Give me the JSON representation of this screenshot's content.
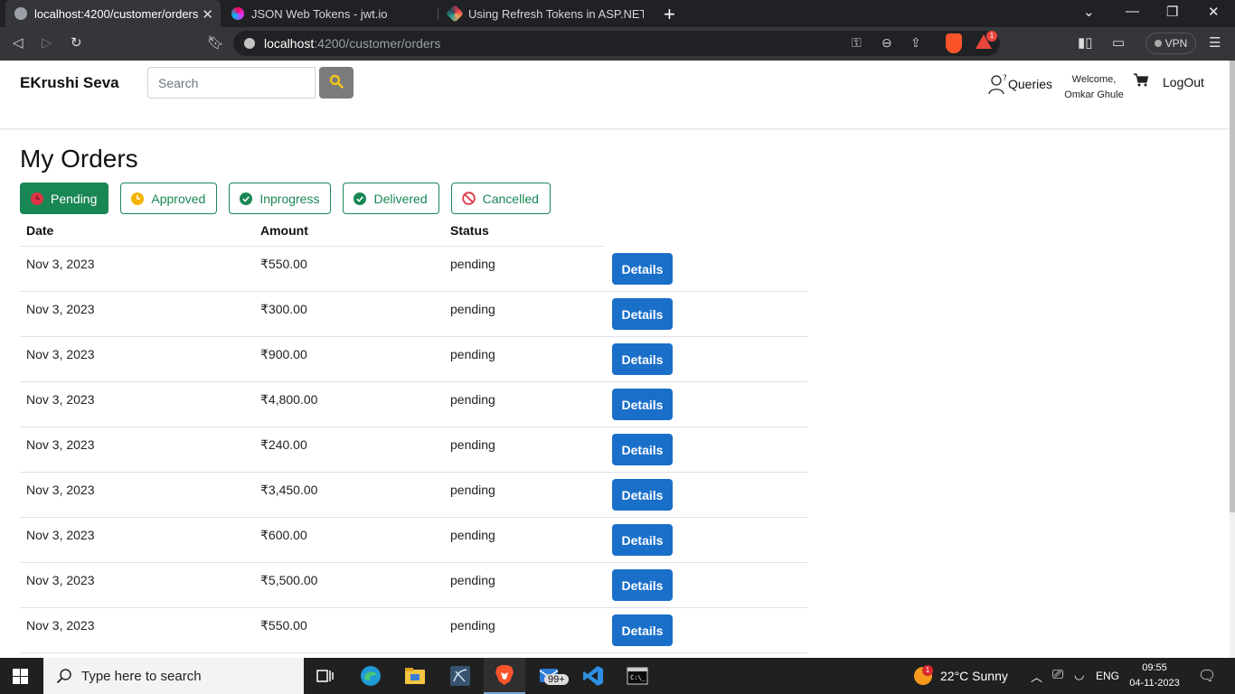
{
  "browser": {
    "tabs": [
      {
        "title": "localhost:4200/customer/orders",
        "active": true
      },
      {
        "title": "JSON Web Tokens - jwt.io",
        "active": false
      },
      {
        "title": "Using Refresh Tokens in ASP.NET Core",
        "active": false
      }
    ],
    "url_host": "localhost",
    "url_rest": ":4200/customer/orders",
    "vpn_label": "VPN",
    "rewards_badge": "1"
  },
  "navbar": {
    "brand": "EKrushi Seva",
    "search_placeholder": "Search",
    "queries_label": "Queries",
    "welcome_line1": "Welcome,",
    "welcome_line2": "Omkar Ghule",
    "logout_label": "LogOut"
  },
  "page": {
    "title": "My Orders",
    "filters": [
      {
        "label": "Pending",
        "icon": "clock-red-icon",
        "active": true
      },
      {
        "label": "Approved",
        "icon": "clock-yellow-icon",
        "active": false
      },
      {
        "label": "Inprogress",
        "icon": "check-green-icon",
        "active": false
      },
      {
        "label": "Delivered",
        "icon": "check-green-icon",
        "active": false
      },
      {
        "label": "Cancelled",
        "icon": "ban-red-icon",
        "active": false
      }
    ],
    "columns": {
      "date": "Date",
      "amount": "Amount",
      "status": "Status"
    },
    "details_label": "Details",
    "orders": [
      {
        "date": "Nov 3, 2023",
        "amount": "₹550.00",
        "status": "pending"
      },
      {
        "date": "Nov 3, 2023",
        "amount": "₹300.00",
        "status": "pending"
      },
      {
        "date": "Nov 3, 2023",
        "amount": "₹900.00",
        "status": "pending"
      },
      {
        "date": "Nov 3, 2023",
        "amount": "₹4,800.00",
        "status": "pending"
      },
      {
        "date": "Nov 3, 2023",
        "amount": "₹240.00",
        "status": "pending"
      },
      {
        "date": "Nov 3, 2023",
        "amount": "₹3,450.00",
        "status": "pending"
      },
      {
        "date": "Nov 3, 2023",
        "amount": "₹600.00",
        "status": "pending"
      },
      {
        "date": "Nov 3, 2023",
        "amount": "₹5,500.00",
        "status": "pending"
      },
      {
        "date": "Nov 3, 2023",
        "amount": "₹550.00",
        "status": "pending"
      }
    ]
  },
  "colors": {
    "success": "#198754",
    "primary": "#1a6fc9",
    "search_button": "#7b7b7b",
    "search_icon": "#f5c518"
  },
  "taskbar": {
    "search_placeholder": "Type here to search",
    "mail_badge": "99+",
    "weather_badge": "1",
    "weather": "22°C  Sunny",
    "lang": "ENG",
    "time": "09:55",
    "date": "04-11-2023"
  }
}
